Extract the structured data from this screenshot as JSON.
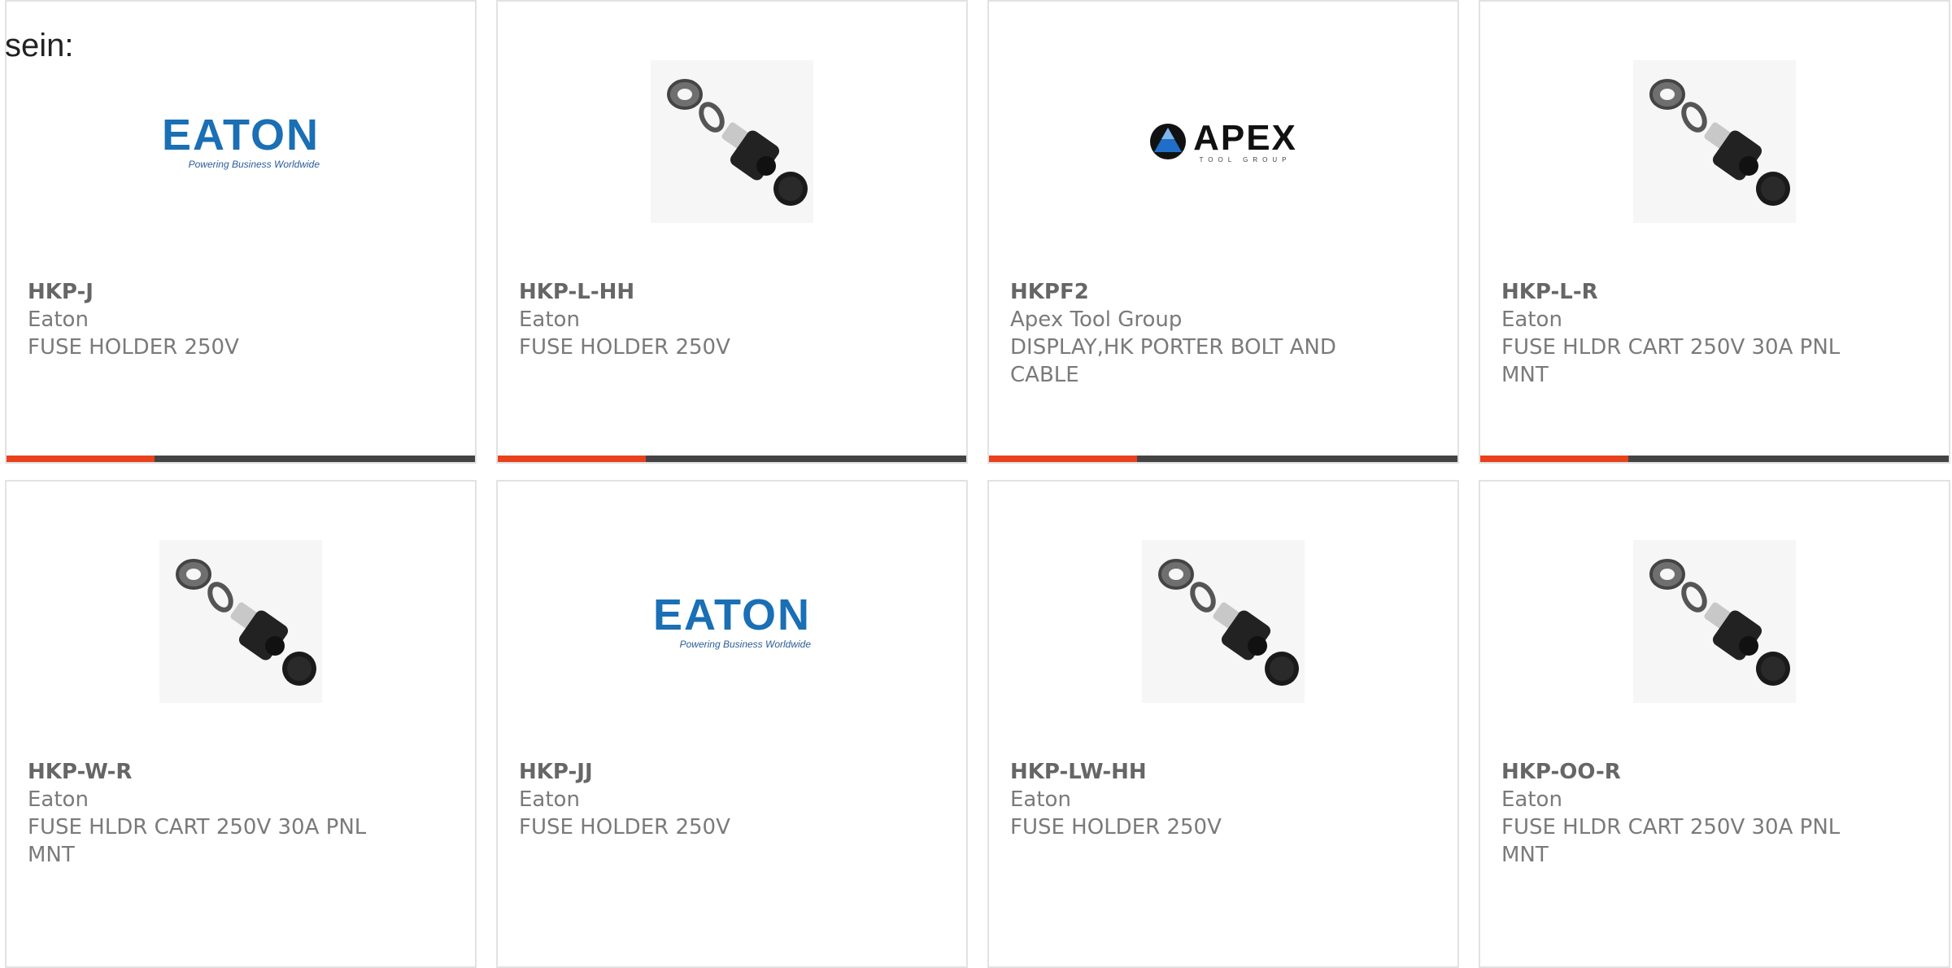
{
  "page": {
    "intro_text": "sein:"
  },
  "brand": {
    "accent": "#e8411b",
    "bar_dark": "#444444",
    "eaton_blue": "#1a6fb5"
  },
  "products": [
    {
      "part_number": "HKP-J",
      "manufacturer": "Eaton",
      "description": "FUSE HOLDER 250V",
      "image": "eaton-logo",
      "logo_word": "EATON",
      "logo_tagline": "Powering Business Worldwide"
    },
    {
      "part_number": "HKP-L-HH",
      "manufacturer": "Eaton",
      "description": "FUSE HOLDER 250V",
      "image": "fuse-holder-photo"
    },
    {
      "part_number": "HKPF2",
      "manufacturer": "Apex Tool Group",
      "description": "DISPLAY,HK PORTER BOLT AND CABLE",
      "image": "apex-logo",
      "logo_word": "APEX",
      "logo_tagline": "TOOL GROUP"
    },
    {
      "part_number": "HKP-L-R",
      "manufacturer": "Eaton",
      "description": "FUSE HLDR CART 250V 30A PNL MNT",
      "image": "fuse-holder-photo"
    },
    {
      "part_number": "HKP-W-R",
      "manufacturer": "Eaton",
      "description": "FUSE HLDR CART 250V 30A PNL MNT",
      "image": "fuse-holder-photo"
    },
    {
      "part_number": "HKP-JJ",
      "manufacturer": "Eaton",
      "description": "FUSE HOLDER 250V",
      "image": "eaton-logo",
      "logo_word": "EATON",
      "logo_tagline": "Powering Business Worldwide"
    },
    {
      "part_number": "HKP-LW-HH",
      "manufacturer": "Eaton",
      "description": "FUSE HOLDER 250V",
      "image": "fuse-holder-photo"
    },
    {
      "part_number": "HKP-OO-R",
      "manufacturer": "Eaton",
      "description": "FUSE HLDR CART 250V 30A PNL MNT",
      "image": "fuse-holder-photo"
    }
  ]
}
